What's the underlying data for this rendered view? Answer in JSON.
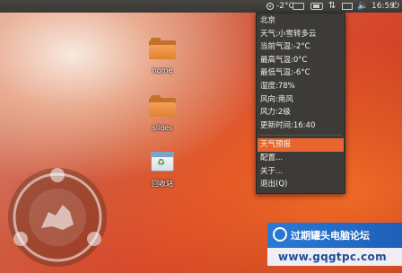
{
  "panel": {
    "weather_icon": "snow-cloud-icon",
    "temperature": "-2°C",
    "net_glyph": "⇅",
    "volume_glyph": "🔈",
    "time": "16:59",
    "power_glyph": "⏻"
  },
  "weather_menu": {
    "info": [
      "北京",
      "天气:小雪转多云",
      "当前气温:-2°C",
      "最高气温:0°C",
      "最低气温:-6°C",
      "湿度:78%",
      "风向:南风",
      "风力:2级",
      "更新时间:16:40"
    ],
    "actions": {
      "forecast": "天气预报",
      "configure": "配置...",
      "about": "关于...",
      "quit": "退出(Q)"
    }
  },
  "desktop": {
    "home_label": "home",
    "slides_label": "slides",
    "trash_label": "回收站"
  },
  "watermark": {
    "title": "过期罐头电脑论坛",
    "url": "www.gqgtpc.com"
  },
  "colors": {
    "panel": "#3c3b37",
    "highlight": "#e8652f",
    "folder": "#e0812f"
  }
}
